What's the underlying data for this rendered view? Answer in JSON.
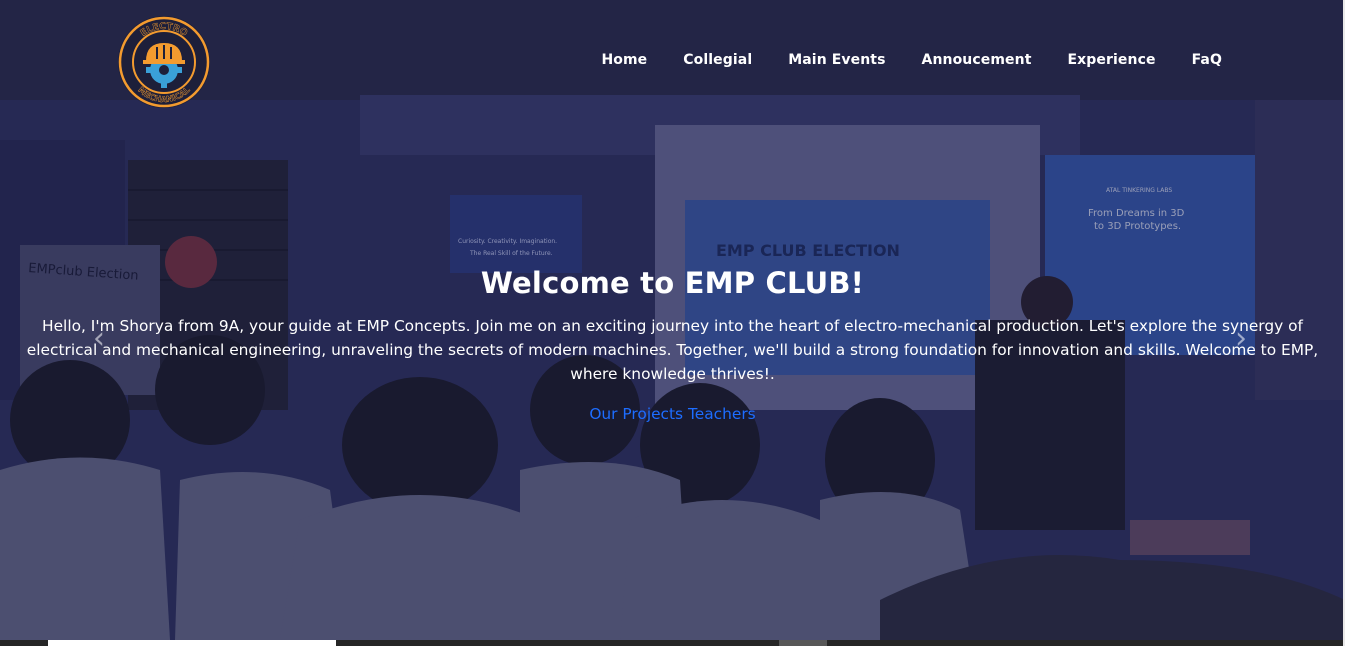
{
  "logo": {
    "top_text": "ELECTRO",
    "bottom_text": "MECHANICAL",
    "alt": "EMP Club logo"
  },
  "nav": {
    "items": [
      {
        "label": "Home"
      },
      {
        "label": "Collegial"
      },
      {
        "label": "Main Events"
      },
      {
        "label": "Annoucement"
      },
      {
        "label": "Experience"
      },
      {
        "label": "FaQ"
      }
    ]
  },
  "hero": {
    "title": "Welcome to EMP CLUB!",
    "description": "Hello, I'm Shorya from 9A, your guide at EMP Concepts. Join me on an exciting journey into the heart of electro-mechanical production. Let's explore the synergy of electrical and mechanical engineering, unraveling the secrets of modern machines. Together, we'll build a strong foundation for innovation and skills. Welcome to EMP, where knowledge thrives!.",
    "link_label": "Our Projects Teachers"
  },
  "background": {
    "board_left": "EMPclub Election",
    "poster_left_line1": "Curiosity. Creativity. Imagination.",
    "poster_left_line2": "The Real Skill of the Future.",
    "screen_title": "EMP CLUB ELECTION",
    "poster_right_header": "ATAL TINKERING LABS",
    "poster_right_line1": "From Dreams in 3D",
    "poster_right_line2": "to 3D Prototypes."
  },
  "controls": {
    "prev_icon": "chevron-left-icon",
    "next_icon": "chevron-right-icon"
  },
  "colors": {
    "link": "#1d6dff",
    "nav_text": "#ffffff",
    "overlay": "#2a2c58"
  }
}
